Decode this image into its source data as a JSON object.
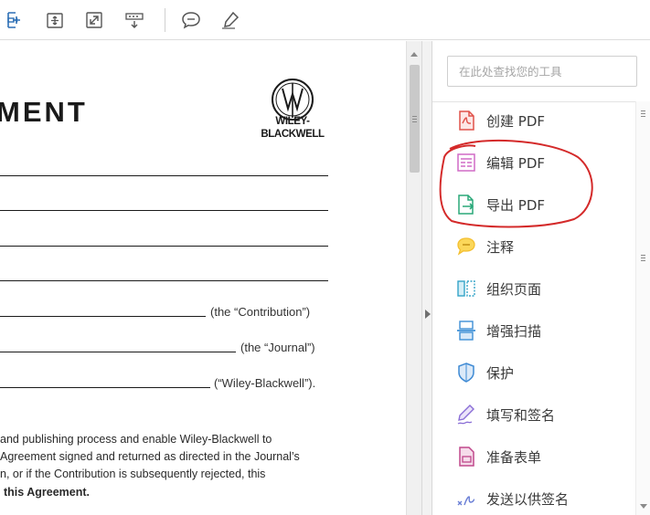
{
  "toolbar": {
    "buttons": [
      {
        "name": "fit-page-icon"
      },
      {
        "name": "rotate-page-icon"
      },
      {
        "name": "full-screen-icon"
      },
      {
        "name": "read-mode-icon"
      },
      {
        "name": "comment-icon"
      },
      {
        "name": "highlight-pen-icon"
      }
    ]
  },
  "document": {
    "title_fragment": "MENT",
    "logo": {
      "line1": "WILEY-",
      "line2": "BLACKWELL"
    },
    "field_labels": {
      "contribution": "(the “Contribution”)",
      "journal": "(the “Journal”)",
      "publisher": "(“Wiley-Blackwell”)."
    },
    "paragraph": [
      "and publishing process and enable Wiley-Blackwell to",
      "Agreement signed and returned as directed in the Journal’s",
      "n, or if the Contribution is subsequently rejected, this"
    ],
    "paragraph_bold": "this Agreement."
  },
  "tools_pane": {
    "search_placeholder": "在此处查找您的工具",
    "items": [
      {
        "label": "创建 PDF",
        "icon": "create-pdf-icon",
        "color": "#e0524a"
      },
      {
        "label": "编辑 PDF",
        "icon": "edit-pdf-icon",
        "color": "#d06ac6"
      },
      {
        "label": "导出 PDF",
        "icon": "export-pdf-icon",
        "color": "#2aa879"
      },
      {
        "label": "注释",
        "icon": "comment-bubble-icon",
        "color": "#f4bf2f"
      },
      {
        "label": "组织页面",
        "icon": "organize-pages-icon",
        "color": "#34a4c8"
      },
      {
        "label": "增强扫描",
        "icon": "enhance-scan-icon",
        "color": "#3d8fd6"
      },
      {
        "label": "保护",
        "icon": "protect-shield-icon",
        "color": "#3e8ad4"
      },
      {
        "label": "填写和签名",
        "icon": "fill-sign-icon",
        "color": "#8a6ed6"
      },
      {
        "label": "准备表单",
        "icon": "prepare-form-icon",
        "color": "#c0488c"
      },
      {
        "label": "发送以供签名",
        "icon": "send-for-signature-icon",
        "color": "#6a7fd6"
      }
    ]
  },
  "annotation_color": "#d42a2a"
}
